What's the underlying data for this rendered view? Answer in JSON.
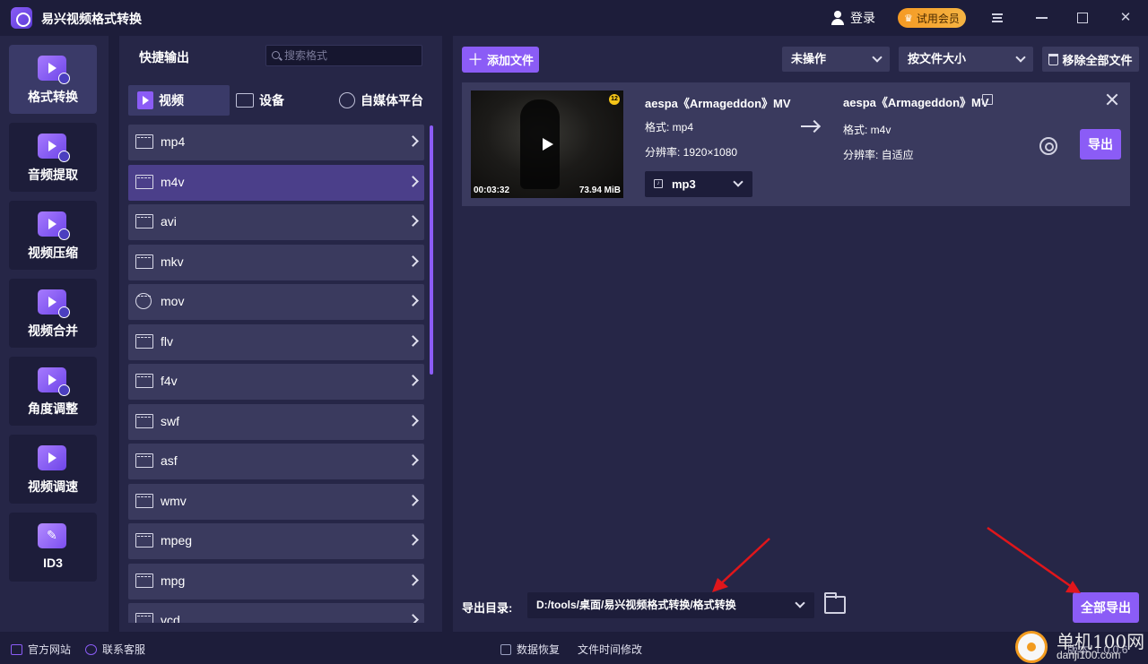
{
  "app": {
    "title": "易兴视频格式转换",
    "login_label": "登录",
    "vip_label": "试用会员"
  },
  "nav": {
    "items": [
      {
        "label": "格式转换",
        "active": true
      },
      {
        "label": "音频提取"
      },
      {
        "label": "视频压缩"
      },
      {
        "label": "视频合并"
      },
      {
        "label": "角度调整"
      },
      {
        "label": "视频调速"
      },
      {
        "label": "ID3"
      }
    ]
  },
  "formats": {
    "title": "快捷输出",
    "search_placeholder": "搜索格式",
    "tabs": [
      {
        "label": "视频"
      },
      {
        "label": "设备"
      },
      {
        "label": "自媒体平台"
      }
    ],
    "items": [
      "mp4",
      "m4v",
      "avi",
      "mkv",
      "mov",
      "flv",
      "f4v",
      "swf",
      "asf",
      "wmv",
      "mpeg",
      "mpg",
      "vcd"
    ],
    "selected_index": 1
  },
  "toolbar": {
    "add_file": "添加文件",
    "operation_select": "未操作",
    "sort_select": "按文件大小",
    "remove_all": "移除全部文件"
  },
  "file": {
    "duration": "00:03:32",
    "size": "73.94 MiB",
    "age_badge": "12",
    "source_name": "aespa《Armageddon》MV",
    "source_format": "格式: mp4",
    "source_resolution": "分辨率: 1920×1080",
    "output_format_select": "mp3",
    "target_name": "aespa《Armageddon》MV",
    "target_format": "格式:  m4v",
    "target_resolution": "分辨率:  自适应",
    "export_label": "导出"
  },
  "output": {
    "dir_label": "导出目录:",
    "dir_value": "D:/tools/桌面/易兴视频格式转换/格式转换",
    "export_all_label": "全部导出"
  },
  "statusbar": {
    "website": "官方网站",
    "support": "联系客服",
    "data_recovery": "数据恢复",
    "file_time": "文件时间修改",
    "version": "版本: 1.0.0.6"
  },
  "watermark": {
    "line1": "单机100网",
    "line2": "danji100.com"
  },
  "colors": {
    "accent": "#8b5cf6",
    "background": "#1d1d3a",
    "panel": "#262647",
    "vip": "#f59a23",
    "annotation_arrow": "#e0161b"
  }
}
